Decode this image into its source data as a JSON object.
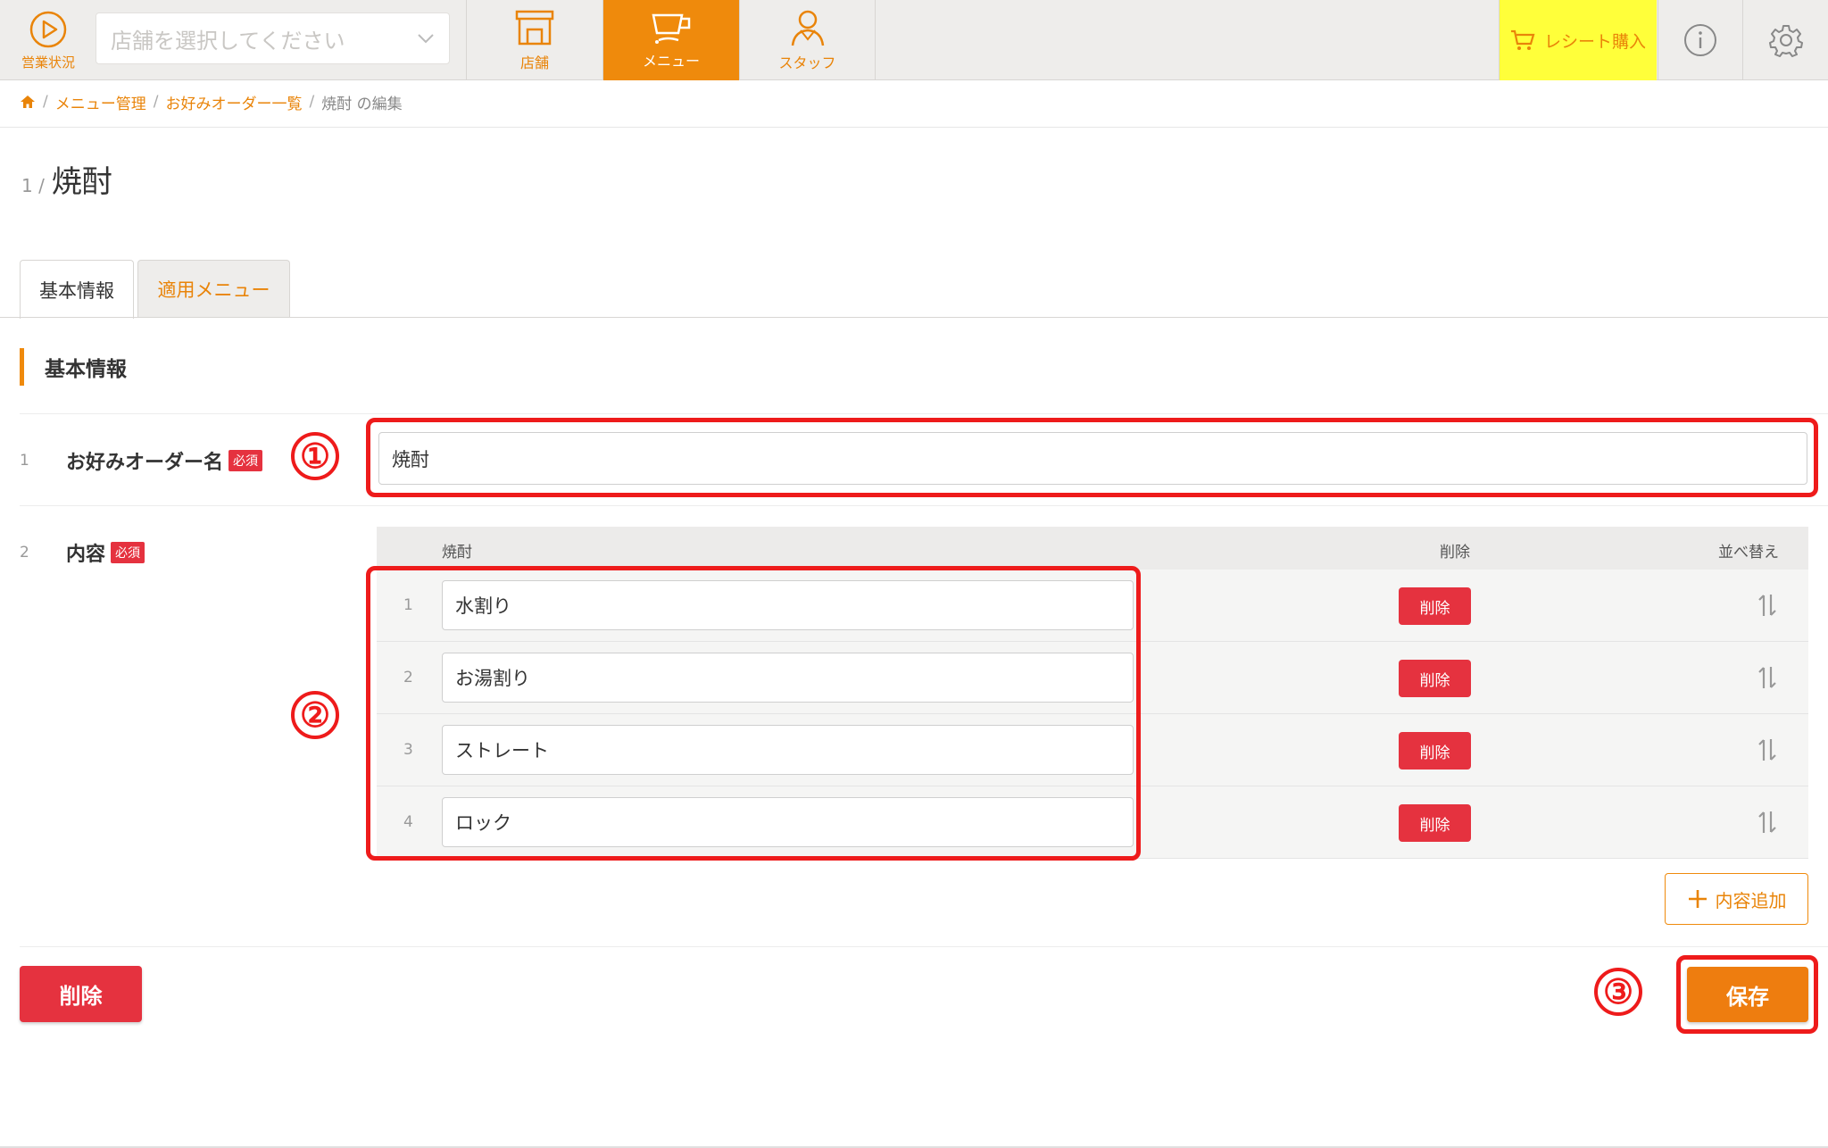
{
  "header": {
    "business_status_label": "営業状況",
    "store_select_placeholder": "店舗を選択してください",
    "nav": [
      {
        "label": "店舗"
      },
      {
        "label": "メニュー"
      },
      {
        "label": "スタッフ"
      }
    ],
    "receipt_label": "レシート購入",
    "accent_color": "#ef8a0c",
    "receipt_bg": "#ffff3a"
  },
  "breadcrumb": [
    "メニュー管理",
    "お好みオーダー一覧",
    "焼酎 の編集"
  ],
  "page": {
    "number": "1 /",
    "title": "焼酎"
  },
  "tabs": [
    "基本情報",
    "適用メニュー"
  ],
  "section_title": "基本情報",
  "form": {
    "name_field": {
      "index": "1",
      "label": "お好みオーダー名",
      "required": "必須",
      "value": "焼酎"
    },
    "content_field": {
      "index": "2",
      "label": "内容",
      "required": "必須"
    }
  },
  "content_table": {
    "headers": {
      "name": "焼酎",
      "delete": "削除",
      "sort": "並べ替え"
    },
    "rows": [
      {
        "index": "1",
        "value": "水割り",
        "delete_label": "削除"
      },
      {
        "index": "2",
        "value": "お湯割り",
        "delete_label": "削除"
      },
      {
        "index": "3",
        "value": "ストレート",
        "delete_label": "削除"
      },
      {
        "index": "4",
        "value": "ロック",
        "delete_label": "削除"
      }
    ],
    "add_label": "内容追加"
  },
  "actions": {
    "delete_label": "削除",
    "save_label": "保存"
  },
  "annotations": [
    "①",
    "②",
    "③"
  ],
  "colors": {
    "danger": "#e5323f",
    "annotation": "#ee1b1b"
  }
}
